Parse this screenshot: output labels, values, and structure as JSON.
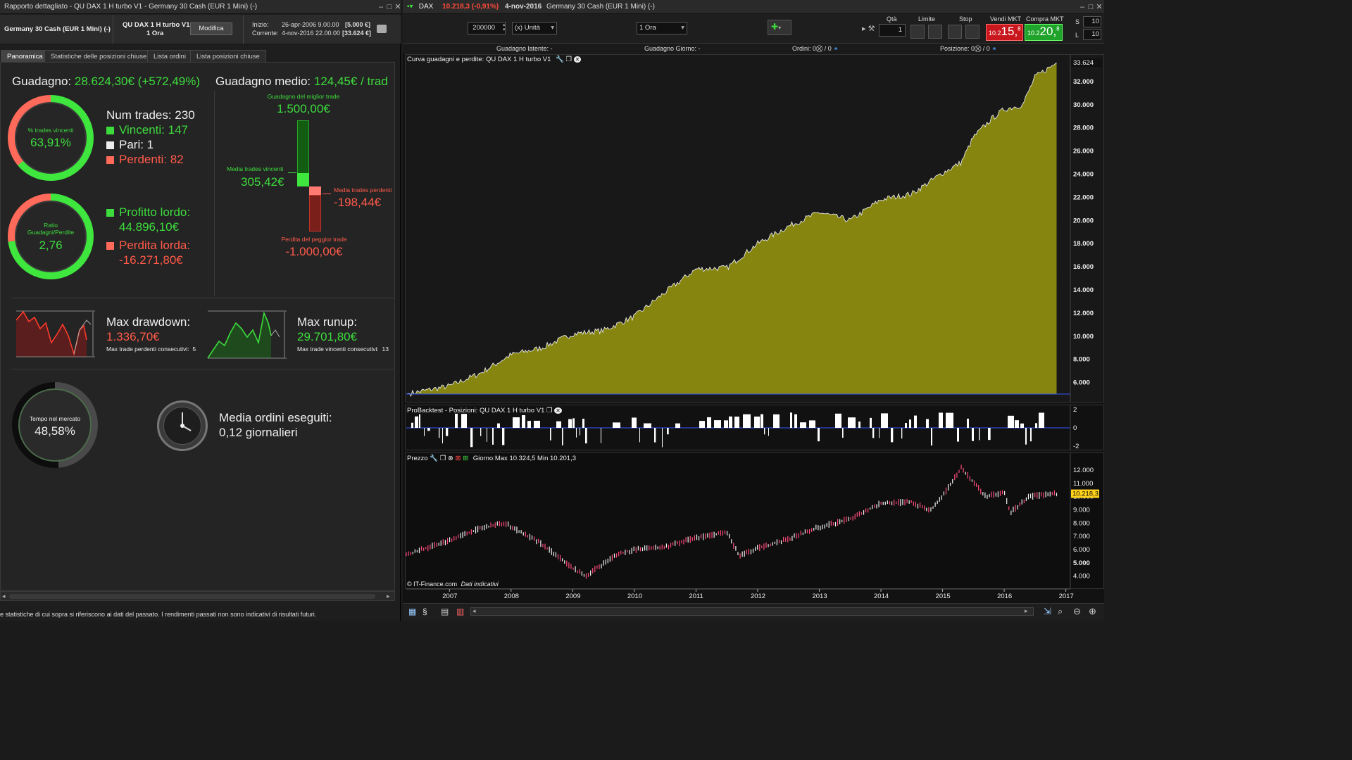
{
  "left_window": {
    "title": "Rapporto dettagliato - QU  DAX 1 H turbo V1 - Germany 30 Cash (EUR 1 Mini) (-)",
    "instrument": "Germany 30 Cash (EUR 1 Mini) (-)",
    "system_name": "QU  DAX 1 H turbo V1",
    "timeframe": "1 Ora",
    "modify_button": "Modifica",
    "start_label": "Inizio:",
    "start_value": "26-apr-2006 9.00.00",
    "start_capital": "[5.000 €]",
    "current_label": "Corrente:",
    "current_value": "4-nov-2016 22.00.00",
    "current_capital": "[33.624 €]",
    "tabs": [
      "Panoramica",
      "Statistiche delle posizioni chiuse",
      "Lista ordini",
      "Lista posizioni chiuse"
    ],
    "gain_label": "Guadagno:",
    "gain_value": "28.624,30€ (+572,49%)",
    "avg_gain_label": "Guadagno medio:",
    "avg_gain_value": "124,45€ / trad",
    "win_ring": {
      "label": "% trades vincenti",
      "value": "63,91%",
      "percent": 63.91
    },
    "num_trades": "Num trades: 230",
    "winners": "Vincenti: 147",
    "ties": "Pari: 1",
    "losers": "Perdenti: 82",
    "ratio_ring": {
      "label": "Ratio Guadagni/Perdite",
      "value": "2,76"
    },
    "gross_profit_label": "Profitto lordo:",
    "gross_profit_value": "44.896,10€",
    "gross_loss_label": "Perdita lorda:",
    "gross_loss_value": "-16.271,80€",
    "best_trade_label": "Guadagno del miglior trade",
    "best_trade_value": "1.500,00€",
    "avg_win_label": "Media trades vincenti",
    "avg_win_value": "305,42€",
    "avg_loss_label": "Media trades perdenti",
    "avg_loss_value": "-198,44€",
    "worst_trade_label": "Perdita del peggior trade",
    "worst_trade_value": "-1.000,00€",
    "max_drawdown_label": "Max drawdown:",
    "max_drawdown_value": "1.336,70€",
    "max_losing_streak": "Max trade perdenti consecutivi:  5",
    "max_runup_label": "Max runup:",
    "max_runup_value": "29.701,80€",
    "max_winning_streak": "Max trade vincenti consecutivi:  13",
    "time_in_market": {
      "label": "Tempo nel mercato",
      "value": "48,58%",
      "percent": 48.58
    },
    "orders_label": "Media ordini eseguiti:",
    "orders_value": "0,12 giornalieri",
    "footer_note": "e statistiche di cui sopra si riferiscono ai dati del passato. I rendimenti passati non sono indicativi di risultati futuri."
  },
  "right_window": {
    "symbol": "DAX",
    "price_change": "10.218,3 (-0,91%)",
    "date": "4-nov-2016",
    "instrument": "Germany 30 Cash (EUR 1 Mini) (-)",
    "quantity_value": "200000",
    "unit_select": "(x) Unità",
    "timeframe_select": "1 Ora",
    "qty_label": "Qtà",
    "qty_value": "1",
    "limit_label": "Limite",
    "stop_label": "Stop",
    "sell_label": "Vendi MKT",
    "sell_price_small": "10.2",
    "sell_price_big": "15,",
    "sell_price_sup": "8",
    "buy_label": "Compra MKT",
    "buy_price_small": "10.2",
    "buy_price_big": "20,",
    "buy_price_sup": "8",
    "s_label": "S",
    "s_value": "10",
    "l_label": "L",
    "l_value": "10",
    "latent_gain": "Guadagno latente:  -",
    "daily_gain": "Guadagno Giorno:  -",
    "orders_label": "Ordini:",
    "orders_value": "0",
    "orders_value2": "/ 0",
    "positions_label": "Posizione:",
    "positions_value": "0",
    "positions_value2": "/ 0",
    "pane1_title": "Curva guadagni e perdite: QU  DAX 1 H turbo V1",
    "pane2_title": "ProBacktest - Posizioni: QU  DAX 1 H turbo V1",
    "pane3_title": "Prezzo",
    "pane3_info": "Giorno:Max 10.324,5 Min 10.201,3",
    "copyright": "© IT-Finance.com",
    "copyright_note": "Dati indicativi",
    "last_price_tag": "10.218,3",
    "equity_last_tag": "33.624",
    "colors": {
      "equity_fill": "#858510",
      "sell": "#c8181e",
      "buy": "#1fa32a",
      "win": "#3ddc3d",
      "loss": "#ff5a4a"
    }
  },
  "chart_data": [
    {
      "type": "area",
      "title": "Curva guadagni e perdite: QU  DAX 1 H turbo V1",
      "x": [
        2006.3,
        2007.0,
        2007.5,
        2008.0,
        2008.5,
        2009.0,
        2009.5,
        2010.0,
        2010.5,
        2011.0,
        2011.5,
        2012.0,
        2012.5,
        2013.0,
        2013.5,
        2014.0,
        2014.5,
        2015.0,
        2015.3,
        2015.5,
        2015.8,
        2016.0,
        2016.3,
        2016.5,
        2016.85
      ],
      "y": [
        5000,
        5700,
        6800,
        8400,
        9000,
        10200,
        10500,
        11700,
        13800,
        15800,
        15900,
        18000,
        19500,
        20700,
        20000,
        21800,
        22300,
        24100,
        25000,
        27200,
        28800,
        29600,
        30000,
        32400,
        33624
      ],
      "ylim": [
        5000,
        34000
      ],
      "y_ticks": [
        "32.000",
        "30.000",
        "28.000",
        "26.000",
        "24.000",
        "22.000",
        "20.000",
        "18.000",
        "16.000",
        "14.000",
        "12.000",
        "10.000",
        "8.000",
        "6.000"
      ],
      "y_tick_values": [
        32000,
        30000,
        28000,
        26000,
        24000,
        22000,
        20000,
        18000,
        16000,
        14000,
        12000,
        10000,
        8000,
        6000
      ],
      "last_value": 33624
    },
    {
      "type": "bar",
      "title": "ProBacktest - Posizioni: QU  DAX 1 H turbo V1",
      "ylim": [
        -2,
        2
      ],
      "y_ticks": [
        "2",
        "0",
        "-2"
      ],
      "y_tick_values": [
        2,
        0,
        -2
      ]
    },
    {
      "type": "line",
      "title": "Prezzo",
      "x": [
        2006.3,
        2007.0,
        2007.5,
        2007.9,
        2008.5,
        2009.0,
        2009.2,
        2009.7,
        2010.0,
        2010.5,
        2011.0,
        2011.5,
        2011.7,
        2012.0,
        2012.5,
        2013.0,
        2013.5,
        2014.0,
        2014.5,
        2014.8,
        2015.0,
        2015.3,
        2015.7,
        2016.0,
        2016.1,
        2016.4,
        2016.85
      ],
      "y": [
        5600,
        6700,
        7600,
        8000,
        6400,
        4600,
        4000,
        5600,
        6000,
        6200,
        6900,
        7300,
        5500,
        6100,
        6800,
        7700,
        8300,
        9500,
        9600,
        8900,
        10000,
        12200,
        10000,
        10300,
        8800,
        10000,
        10218
      ],
      "ylim": [
        3500,
        12800
      ],
      "y_ticks": [
        "12.000",
        "11.000",
        "10.000",
        "9.000",
        "8.000",
        "7.000",
        "6.000",
        "5.000",
        "4.000"
      ],
      "y_tick_values": [
        12000,
        11000,
        10000,
        9000,
        8000,
        7000,
        6000,
        5000,
        4000
      ],
      "x_labels": [
        "2007",
        "2008",
        "2009",
        "2010",
        "2011",
        "2012",
        "2013",
        "2014",
        "2015",
        "2016",
        "2017"
      ],
      "last_value": 10218.3
    }
  ]
}
